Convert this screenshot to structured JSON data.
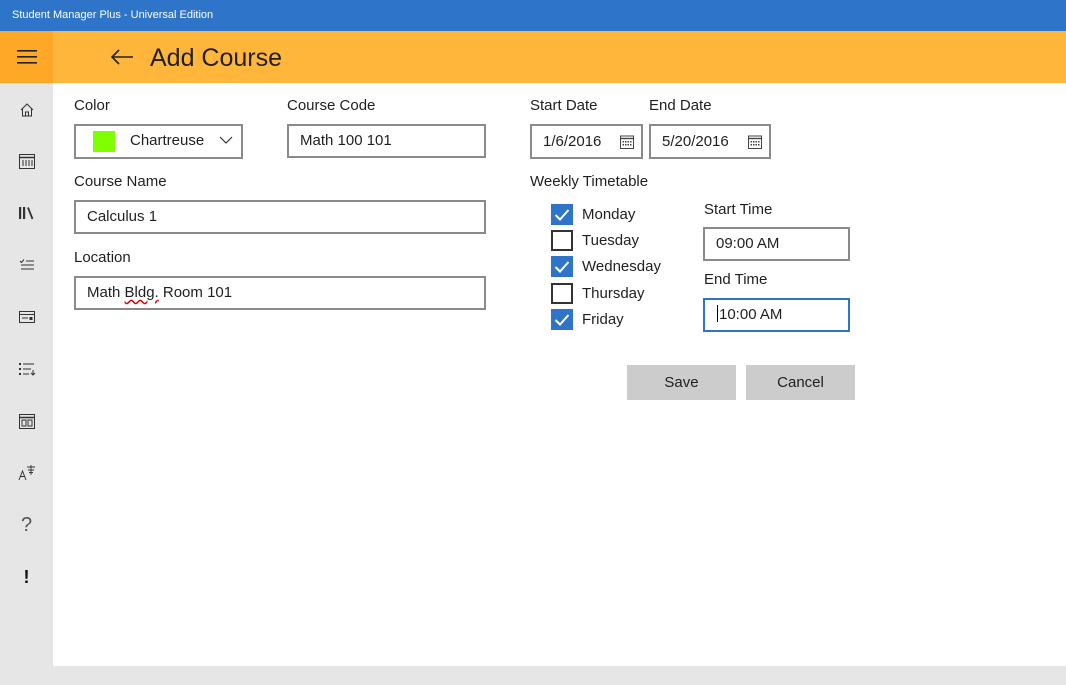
{
  "window": {
    "title": "Student Manager Plus - Universal Edition"
  },
  "header": {
    "title": "Add Course",
    "back_icon": "back-arrow-icon",
    "menu_icon": "hamburger-icon",
    "background": "#ffb63b"
  },
  "sidebar": {
    "items": [
      {
        "name": "home-icon"
      },
      {
        "name": "calendar-icon"
      },
      {
        "name": "library-icon"
      },
      {
        "name": "checklist-icon"
      },
      {
        "name": "card-icon"
      },
      {
        "name": "list-icon"
      },
      {
        "name": "timetable-icon"
      },
      {
        "name": "language-icon"
      },
      {
        "name": "help-icon",
        "glyph": "?"
      },
      {
        "name": "alert-icon",
        "glyph": "!"
      }
    ]
  },
  "form": {
    "color": {
      "label": "Color",
      "value": "Chartreuse",
      "swatch": "#7fff00"
    },
    "course_code": {
      "label": "Course Code",
      "value": "Math 100 101"
    },
    "course_name": {
      "label": "Course Name",
      "value": "Calculus 1"
    },
    "location": {
      "label": "Location",
      "value_prefix": "Math ",
      "value_misspelled": "Bldg.",
      "value_suffix": " Room 101"
    },
    "start_date": {
      "label": "Start Date",
      "value": "1/6/2016"
    },
    "end_date": {
      "label": "End Date",
      "value": "5/20/2016"
    },
    "timetable": {
      "label": "Weekly Timetable",
      "days": [
        {
          "label": "Monday",
          "checked": true
        },
        {
          "label": "Tuesday",
          "checked": false
        },
        {
          "label": "Wednesday",
          "checked": true
        },
        {
          "label": "Thursday",
          "checked": false
        },
        {
          "label": "Friday",
          "checked": true
        }
      ]
    },
    "start_time": {
      "label": "Start Time",
      "value": "09:00 AM"
    },
    "end_time": {
      "label": "End Time",
      "value": "10:00 AM"
    }
  },
  "actions": {
    "save": "Save",
    "cancel": "Cancel"
  }
}
